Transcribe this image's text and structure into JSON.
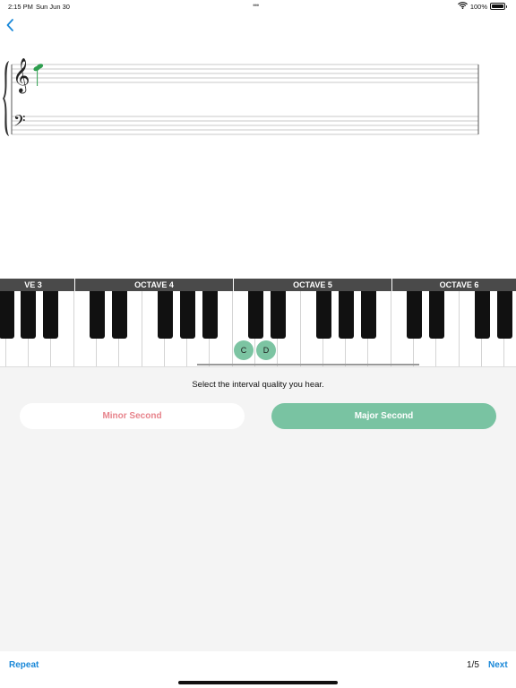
{
  "status_bar": {
    "time": "2:15 PM",
    "date": "Sun Jun 30",
    "dots": "•••",
    "battery": "100%"
  },
  "icons": {
    "back": "chevron-left-icon",
    "wifi": "wifi-icon",
    "battery": "battery-icon",
    "treble_clef": "treble-clef-icon",
    "bass_clef": "bass-clef-icon"
  },
  "colors": {
    "accent": "#1a88d8",
    "correct": "#79c3a2",
    "incorrect": "#e7838b",
    "note": "#2e9e4f"
  },
  "piano": {
    "octaves": [
      "VE 3",
      "OCTAVE 4",
      "OCTAVE 5",
      "OCTAVE 6"
    ],
    "markers": [
      "C",
      "D"
    ]
  },
  "quiz": {
    "prompt": "Select the interval quality you hear.",
    "options": [
      "Minor Second",
      "Major Second"
    ],
    "progress": "1/5"
  },
  "footer": {
    "repeat_label": "Repeat",
    "next_label": "Next"
  }
}
